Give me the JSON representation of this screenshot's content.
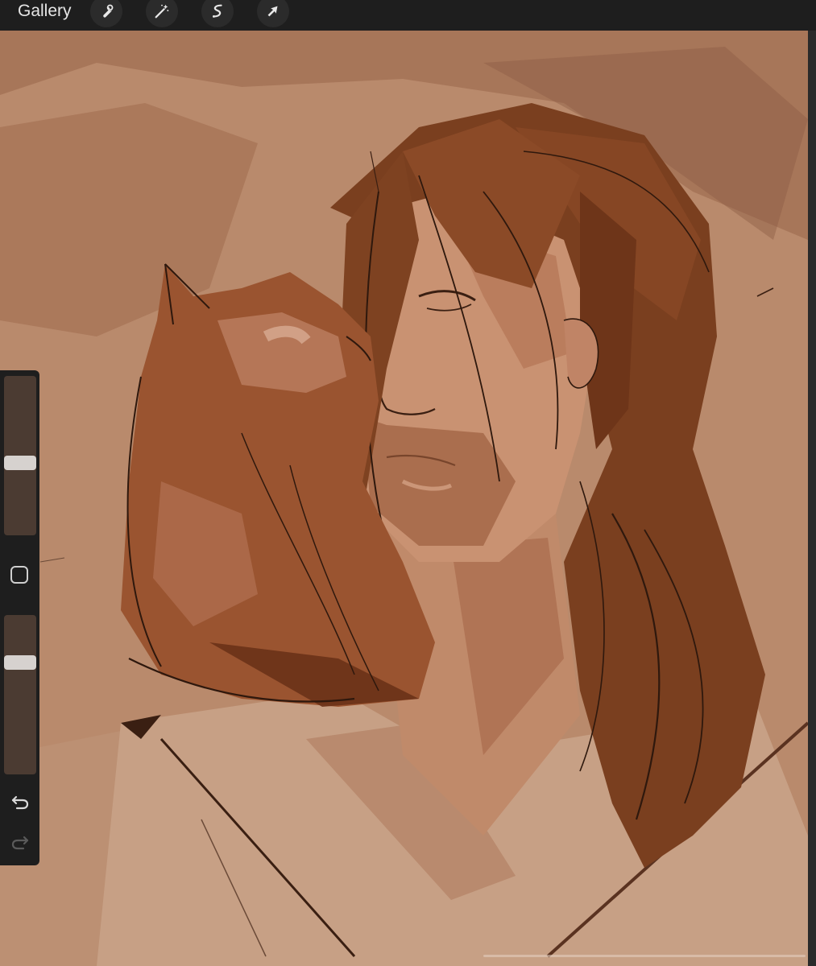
{
  "toolbar": {
    "gallery_label": "Gallery",
    "tools": [
      "wrench-icon",
      "magic-wand-icon",
      "selection-icon",
      "transform-arrow-icon"
    ]
  },
  "sidebar": {
    "brush_size": 0.45,
    "opacity": 0.72,
    "buttons": [
      "modify-square",
      "undo-icon",
      "redo-icon"
    ]
  },
  "colors": {
    "toolbar_bg": "#1e1e1e",
    "canvas_bg": "#b98a6c",
    "hair": "#7a3f1f",
    "skin": "#c99272",
    "cat": "#9a5430",
    "ink": "#3a1f12"
  }
}
